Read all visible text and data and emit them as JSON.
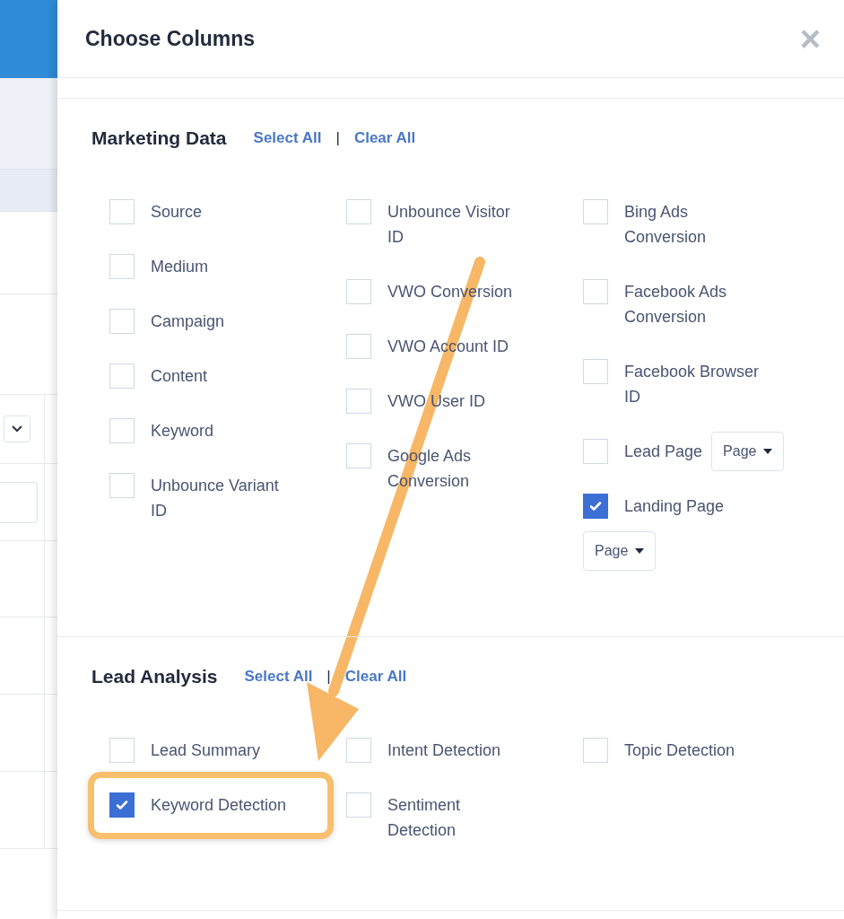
{
  "dialog": {
    "title": "Choose Columns",
    "close": "×"
  },
  "sections": [
    {
      "title": "Marketing Data",
      "select_all": "Select All",
      "separator": "|",
      "clear_all": "Clear All",
      "columns": [
        [
          {
            "label": "Source",
            "checked": false
          },
          {
            "label": "Medium",
            "checked": false
          },
          {
            "label": "Campaign",
            "checked": false
          },
          {
            "label": "Content",
            "checked": false
          },
          {
            "label": "Keyword",
            "checked": false
          },
          {
            "label": "Unbounce Variant ID",
            "checked": false
          }
        ],
        [
          {
            "label": "Unbounce Visitor ID",
            "checked": false
          },
          {
            "label": "VWO Conversion",
            "checked": false
          },
          {
            "label": "VWO Account ID",
            "checked": false
          },
          {
            "label": "VWO User ID",
            "checked": false
          },
          {
            "label": "Google Ads Conversion",
            "checked": false
          }
        ],
        [
          {
            "label": "Bing Ads Conversion",
            "checked": false
          },
          {
            "label": "Facebook Ads Conversion",
            "checked": false
          },
          {
            "label": "Facebook Browser ID",
            "checked": false
          },
          {
            "label": "Lead Page",
            "checked": false,
            "select": "Page"
          },
          {
            "label": "Landing Page",
            "checked": true,
            "select": "Page"
          }
        ]
      ]
    },
    {
      "title": "Lead Analysis",
      "select_all": "Select All",
      "separator": "|",
      "clear_all": "Clear All",
      "columns": [
        [
          {
            "label": "Lead Summary",
            "checked": false
          },
          {
            "label": "Keyword Detection",
            "checked": true
          }
        ],
        [
          {
            "label": "Intent Detection",
            "checked": false
          },
          {
            "label": "Sentiment Detection",
            "checked": false
          }
        ],
        [
          {
            "label": "Topic Detection",
            "checked": false
          }
        ]
      ]
    }
  ]
}
